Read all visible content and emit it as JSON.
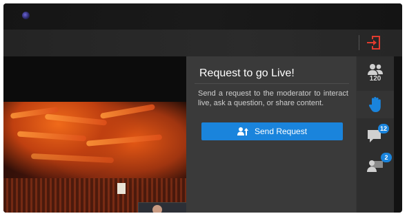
{
  "colors": {
    "accent": "#1a84dc",
    "exit": "#e23b2e",
    "hand": "#1a84dc",
    "panel_bg": "#3a3a3a"
  },
  "header": {
    "exit_icon": "exit-door-icon"
  },
  "request_panel": {
    "title": "Request to go Live!",
    "description": "Send a request to the moderator to interact live, ask a question, or share content.",
    "send_button_label": "Send Request",
    "send_button_icon": "user-up-arrow-icon"
  },
  "side_rail": {
    "participants": {
      "icon": "participants-icon",
      "count": "120"
    },
    "raise_hand": {
      "icon": "raised-hand-icon"
    },
    "chat": {
      "icon": "chat-bubble-icon",
      "badge": "12"
    },
    "requests": {
      "icon": "user-request-icon",
      "badge": "2"
    }
  }
}
